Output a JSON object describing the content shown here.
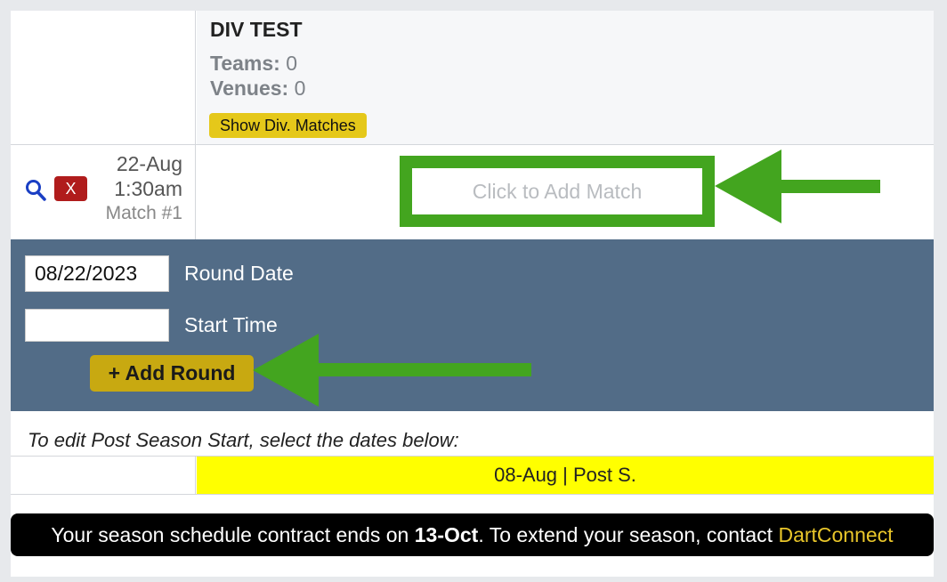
{
  "division": {
    "title": "DIV TEST",
    "teams_label": "Teams:",
    "teams_value": "0",
    "venues_label": "Venues:",
    "venues_value": "0",
    "show_matches_label": "Show Div. Matches"
  },
  "match": {
    "date": "22-Aug",
    "time": "1:30am",
    "number": "Match #1",
    "delete_label": "X",
    "add_match_label": "Click to Add Match"
  },
  "round_form": {
    "date_value": "08/22/2023",
    "date_label": "Round Date",
    "time_value": "",
    "time_label": "Start Time",
    "add_round_label": "+ Add Round"
  },
  "post_season": {
    "note": "To edit Post Season Start, select the dates below:",
    "date_cell": "08-Aug | Post S."
  },
  "contract": {
    "text_before": "Your season schedule contract ends on ",
    "end_date": "13-Oct",
    "text_after": ". To extend your season, contact ",
    "link": "DartConnect"
  },
  "colors": {
    "accent_yellow": "#e5c81a",
    "annotation_green": "#43a51f",
    "panel_blue": "#526c87",
    "delete_red": "#b01c1c",
    "highlight_yellow": "#ffff00"
  },
  "icons": [
    "search-icon",
    "arrow-left-icon"
  ]
}
